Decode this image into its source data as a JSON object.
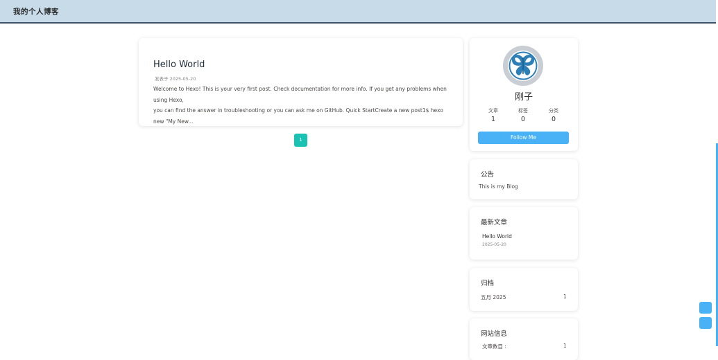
{
  "header": {
    "site_title": "我的个人博客"
  },
  "post": {
    "title": "Hello World",
    "meta": "发表于 2025-05-20",
    "excerpt_line1": "Welcome to Hexo! This is your very first post. Check documentation for more info. If you get any problems when using Hexo,",
    "excerpt_line2": "you can find the answer in troubleshooting or you can ask me on GitHub. Quick StartCreate a new post1$ hexo new \"My New..."
  },
  "pagination": {
    "current": "1"
  },
  "profile": {
    "name": "刚子",
    "stats": [
      {
        "label": "文章",
        "value": "1"
      },
      {
        "label": "标签",
        "value": "0"
      },
      {
        "label": "分类",
        "value": "0"
      }
    ],
    "follow_label": "Follow Me"
  },
  "announcement": {
    "title": "公告",
    "text": "This is my Blog"
  },
  "recent": {
    "title": "最新文章",
    "items": [
      {
        "title": "Hello World",
        "date": "2025-05-20"
      }
    ]
  },
  "archive": {
    "title": "归档",
    "items": [
      {
        "label": "五月 2025",
        "count": "1"
      }
    ]
  },
  "site_info": {
    "title": "网站信息",
    "row_label": "文章数目 :",
    "row_value": "1"
  },
  "colors": {
    "header_bg": "#c7dbe8",
    "accent": "#49b1f5",
    "pager": "#19c2b2"
  }
}
